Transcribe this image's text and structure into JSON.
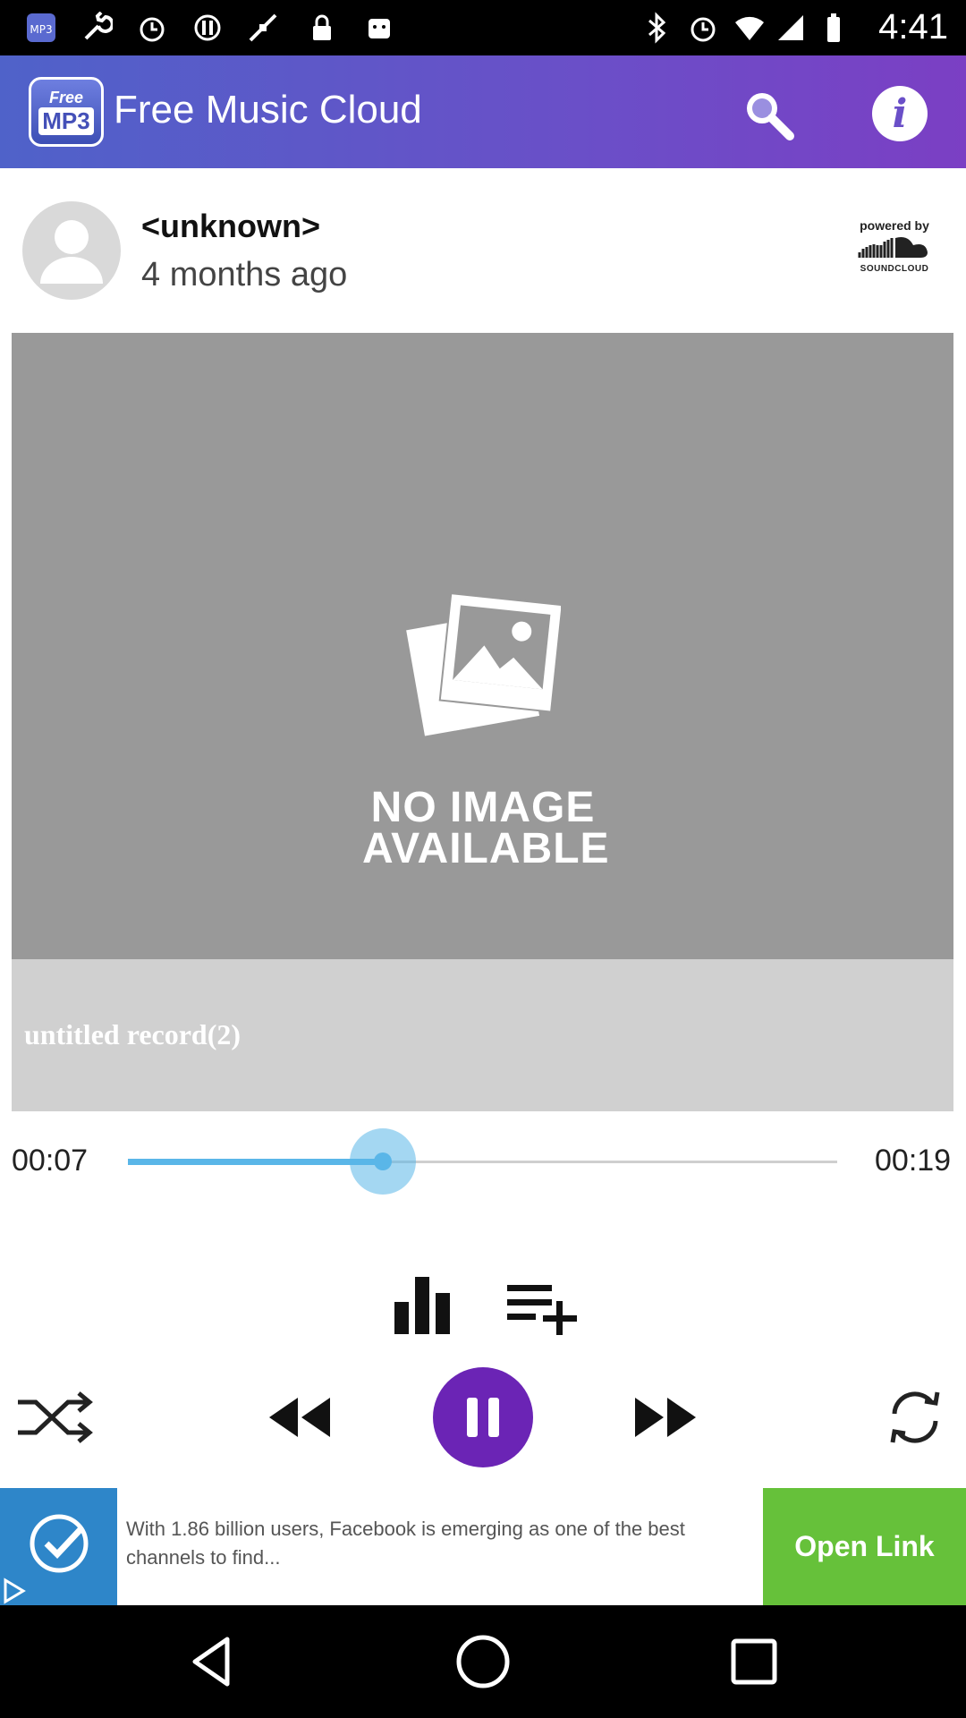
{
  "status_bar": {
    "time": "4:41"
  },
  "app_bar": {
    "logo_free": "Free",
    "logo_mp3": "MP3",
    "title": "Free Music Cloud",
    "info_glyph": "i"
  },
  "track": {
    "user": "<unknown>",
    "posted": "4 months ago",
    "powered_by": "powered by",
    "provider": "SOUNDCLOUD",
    "no_image": "NO IMAGE AVAILABLE",
    "title": "untitled record(2)"
  },
  "progress": {
    "elapsed": "00:07",
    "total": "00:19",
    "fraction": 0.36
  },
  "ad": {
    "text": "With 1.86 billion users, Facebook is emerging as one of the best channels to find...",
    "button": "Open Link"
  },
  "colors": {
    "accent": "#6b24b5",
    "progress": "#5ab6e8",
    "ad_button": "#66c13a"
  },
  "icons": [
    "app-logo-icon",
    "search-icon",
    "info-icon",
    "avatar-icon",
    "soundcloud-logo-icon",
    "no-image-icon",
    "equalizer-icon",
    "add-to-playlist-icon",
    "shuffle-icon",
    "rewind-icon",
    "pause-icon",
    "fast-forward-icon",
    "repeat-icon",
    "back-icon",
    "home-icon",
    "recents-icon"
  ]
}
